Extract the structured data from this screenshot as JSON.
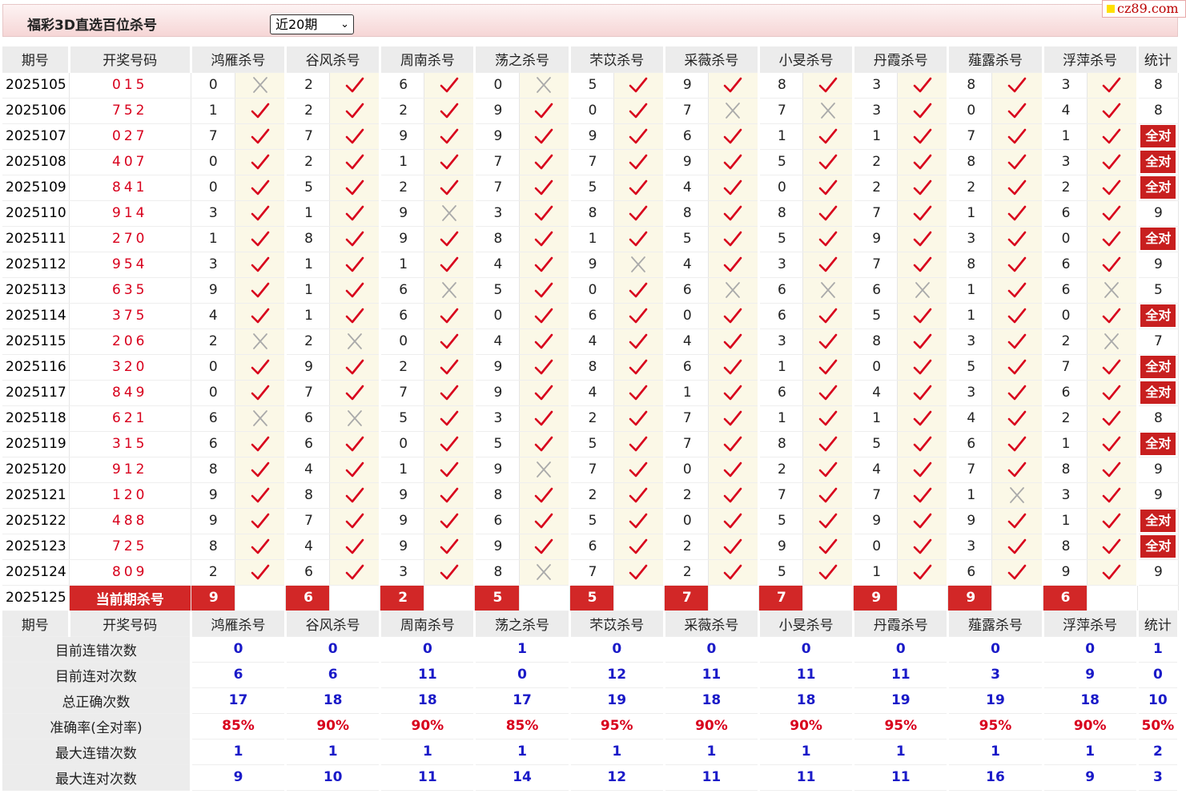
{
  "header": {
    "title": "福彩3D直选百位杀号",
    "select_value": "近20期",
    "logo": "cz89.com"
  },
  "table": {
    "headers": [
      "期号",
      "开奖号码",
      "鸿雁杀号",
      "谷风杀号",
      "周南杀号",
      "荡之杀号",
      "芣苡杀号",
      "采薇杀号",
      "小旻杀号",
      "丹霞杀号",
      "薤露杀号",
      "浮萍杀号",
      "统计"
    ],
    "rows": [
      {
        "period": "2025105",
        "draw": "015",
        "kills": [
          [
            "0",
            0
          ],
          [
            "2",
            1
          ],
          [
            "6",
            1
          ],
          [
            "0",
            0
          ],
          [
            "5",
            1
          ],
          [
            "9",
            1
          ],
          [
            "8",
            1
          ],
          [
            "3",
            1
          ],
          [
            "8",
            1
          ],
          [
            "3",
            1
          ]
        ],
        "stat": "8"
      },
      {
        "period": "2025106",
        "draw": "752",
        "kills": [
          [
            "1",
            1
          ],
          [
            "2",
            1
          ],
          [
            "2",
            1
          ],
          [
            "9",
            1
          ],
          [
            "0",
            1
          ],
          [
            "7",
            0
          ],
          [
            "7",
            0
          ],
          [
            "3",
            1
          ],
          [
            "0",
            1
          ],
          [
            "4",
            1
          ]
        ],
        "stat": "8"
      },
      {
        "period": "2025107",
        "draw": "027",
        "kills": [
          [
            "7",
            1
          ],
          [
            "7",
            1
          ],
          [
            "9",
            1
          ],
          [
            "9",
            1
          ],
          [
            "9",
            1
          ],
          [
            "6",
            1
          ],
          [
            "1",
            1
          ],
          [
            "1",
            1
          ],
          [
            "7",
            1
          ],
          [
            "1",
            1
          ]
        ],
        "stat": "全对"
      },
      {
        "period": "2025108",
        "draw": "407",
        "kills": [
          [
            "0",
            1
          ],
          [
            "2",
            1
          ],
          [
            "1",
            1
          ],
          [
            "7",
            1
          ],
          [
            "7",
            1
          ],
          [
            "9",
            1
          ],
          [
            "5",
            1
          ],
          [
            "2",
            1
          ],
          [
            "8",
            1
          ],
          [
            "3",
            1
          ]
        ],
        "stat": "全对"
      },
      {
        "period": "2025109",
        "draw": "841",
        "kills": [
          [
            "0",
            1
          ],
          [
            "5",
            1
          ],
          [
            "2",
            1
          ],
          [
            "7",
            1
          ],
          [
            "5",
            1
          ],
          [
            "4",
            1
          ],
          [
            "0",
            1
          ],
          [
            "2",
            1
          ],
          [
            "2",
            1
          ],
          [
            "2",
            1
          ]
        ],
        "stat": "全对"
      },
      {
        "period": "2025110",
        "draw": "914",
        "kills": [
          [
            "3",
            1
          ],
          [
            "1",
            1
          ],
          [
            "9",
            0
          ],
          [
            "3",
            1
          ],
          [
            "8",
            1
          ],
          [
            "8",
            1
          ],
          [
            "8",
            1
          ],
          [
            "7",
            1
          ],
          [
            "1",
            1
          ],
          [
            "6",
            1
          ]
        ],
        "stat": "9"
      },
      {
        "period": "2025111",
        "draw": "270",
        "kills": [
          [
            "1",
            1
          ],
          [
            "8",
            1
          ],
          [
            "9",
            1
          ],
          [
            "8",
            1
          ],
          [
            "1",
            1
          ],
          [
            "5",
            1
          ],
          [
            "5",
            1
          ],
          [
            "9",
            1
          ],
          [
            "3",
            1
          ],
          [
            "0",
            1
          ]
        ],
        "stat": "全对"
      },
      {
        "period": "2025112",
        "draw": "954",
        "kills": [
          [
            "3",
            1
          ],
          [
            "1",
            1
          ],
          [
            "1",
            1
          ],
          [
            "4",
            1
          ],
          [
            "9",
            0
          ],
          [
            "4",
            1
          ],
          [
            "3",
            1
          ],
          [
            "7",
            1
          ],
          [
            "8",
            1
          ],
          [
            "6",
            1
          ]
        ],
        "stat": "9"
      },
      {
        "period": "2025113",
        "draw": "635",
        "kills": [
          [
            "9",
            1
          ],
          [
            "1",
            1
          ],
          [
            "6",
            0
          ],
          [
            "5",
            1
          ],
          [
            "0",
            1
          ],
          [
            "6",
            0
          ],
          [
            "6",
            0
          ],
          [
            "6",
            0
          ],
          [
            "1",
            1
          ],
          [
            "6",
            0
          ]
        ],
        "stat": "5"
      },
      {
        "period": "2025114",
        "draw": "375",
        "kills": [
          [
            "4",
            1
          ],
          [
            "1",
            1
          ],
          [
            "6",
            1
          ],
          [
            "0",
            1
          ],
          [
            "6",
            1
          ],
          [
            "0",
            1
          ],
          [
            "6",
            1
          ],
          [
            "5",
            1
          ],
          [
            "1",
            1
          ],
          [
            "0",
            1
          ]
        ],
        "stat": "全对"
      },
      {
        "period": "2025115",
        "draw": "206",
        "kills": [
          [
            "2",
            0
          ],
          [
            "2",
            0
          ],
          [
            "0",
            1
          ],
          [
            "4",
            1
          ],
          [
            "4",
            1
          ],
          [
            "4",
            1
          ],
          [
            "3",
            1
          ],
          [
            "8",
            1
          ],
          [
            "3",
            1
          ],
          [
            "2",
            0
          ]
        ],
        "stat": "7"
      },
      {
        "period": "2025116",
        "draw": "320",
        "kills": [
          [
            "0",
            1
          ],
          [
            "9",
            1
          ],
          [
            "2",
            1
          ],
          [
            "9",
            1
          ],
          [
            "8",
            1
          ],
          [
            "6",
            1
          ],
          [
            "1",
            1
          ],
          [
            "0",
            1
          ],
          [
            "5",
            1
          ],
          [
            "7",
            1
          ]
        ],
        "stat": "全对"
      },
      {
        "period": "2025117",
        "draw": "849",
        "kills": [
          [
            "0",
            1
          ],
          [
            "7",
            1
          ],
          [
            "7",
            1
          ],
          [
            "9",
            1
          ],
          [
            "4",
            1
          ],
          [
            "1",
            1
          ],
          [
            "6",
            1
          ],
          [
            "4",
            1
          ],
          [
            "3",
            1
          ],
          [
            "6",
            1
          ]
        ],
        "stat": "全对"
      },
      {
        "period": "2025118",
        "draw": "621",
        "kills": [
          [
            "6",
            0
          ],
          [
            "6",
            0
          ],
          [
            "5",
            1
          ],
          [
            "3",
            1
          ],
          [
            "2",
            1
          ],
          [
            "7",
            1
          ],
          [
            "1",
            1
          ],
          [
            "1",
            1
          ],
          [
            "4",
            1
          ],
          [
            "2",
            1
          ]
        ],
        "stat": "8"
      },
      {
        "period": "2025119",
        "draw": "315",
        "kills": [
          [
            "6",
            1
          ],
          [
            "6",
            1
          ],
          [
            "0",
            1
          ],
          [
            "5",
            1
          ],
          [
            "5",
            1
          ],
          [
            "7",
            1
          ],
          [
            "8",
            1
          ],
          [
            "5",
            1
          ],
          [
            "6",
            1
          ],
          [
            "1",
            1
          ]
        ],
        "stat": "全对"
      },
      {
        "period": "2025120",
        "draw": "912",
        "kills": [
          [
            "8",
            1
          ],
          [
            "4",
            1
          ],
          [
            "1",
            1
          ],
          [
            "9",
            0
          ],
          [
            "7",
            1
          ],
          [
            "0",
            1
          ],
          [
            "2",
            1
          ],
          [
            "4",
            1
          ],
          [
            "7",
            1
          ],
          [
            "8",
            1
          ]
        ],
        "stat": "9"
      },
      {
        "period": "2025121",
        "draw": "120",
        "kills": [
          [
            "9",
            1
          ],
          [
            "8",
            1
          ],
          [
            "9",
            1
          ],
          [
            "8",
            1
          ],
          [
            "2",
            1
          ],
          [
            "2",
            1
          ],
          [
            "7",
            1
          ],
          [
            "7",
            1
          ],
          [
            "1",
            0
          ],
          [
            "3",
            1
          ]
        ],
        "stat": "9"
      },
      {
        "period": "2025122",
        "draw": "488",
        "kills": [
          [
            "9",
            1
          ],
          [
            "7",
            1
          ],
          [
            "9",
            1
          ],
          [
            "6",
            1
          ],
          [
            "5",
            1
          ],
          [
            "0",
            1
          ],
          [
            "5",
            1
          ],
          [
            "9",
            1
          ],
          [
            "9",
            1
          ],
          [
            "1",
            1
          ]
        ],
        "stat": "全对"
      },
      {
        "period": "2025123",
        "draw": "725",
        "kills": [
          [
            "8",
            1
          ],
          [
            "4",
            1
          ],
          [
            "9",
            1
          ],
          [
            "9",
            1
          ],
          [
            "6",
            1
          ],
          [
            "2",
            1
          ],
          [
            "9",
            1
          ],
          [
            "0",
            1
          ],
          [
            "3",
            1
          ],
          [
            "8",
            1
          ]
        ],
        "stat": "全对"
      },
      {
        "period": "2025124",
        "draw": "809",
        "kills": [
          [
            "2",
            1
          ],
          [
            "6",
            1
          ],
          [
            "3",
            1
          ],
          [
            "8",
            0
          ],
          [
            "7",
            1
          ],
          [
            "2",
            1
          ],
          [
            "5",
            1
          ],
          [
            "1",
            1
          ],
          [
            "6",
            1
          ],
          [
            "9",
            1
          ]
        ],
        "stat": "9"
      }
    ],
    "current": {
      "period": "2025125",
      "label": "当前期杀号",
      "kills": [
        "9",
        "6",
        "2",
        "5",
        "5",
        "7",
        "7",
        "9",
        "9",
        "6"
      ]
    }
  },
  "stats": {
    "headers": [
      "期号",
      "开奖号码",
      "鸿雁杀号",
      "谷风杀号",
      "周南杀号",
      "荡之杀号",
      "芣苡杀号",
      "采薇杀号",
      "小旻杀号",
      "丹霞杀号",
      "薤露杀号",
      "浮萍杀号",
      "统计"
    ],
    "rows": [
      {
        "label": "目前连错次数",
        "values": [
          "0",
          "0",
          "0",
          "1",
          "0",
          "0",
          "0",
          "0",
          "0",
          "0",
          "1"
        ],
        "red": false
      },
      {
        "label": "目前连对次数",
        "values": [
          "6",
          "6",
          "11",
          "0",
          "12",
          "11",
          "11",
          "11",
          "3",
          "9",
          "0"
        ],
        "red": false
      },
      {
        "label": "总正确次数",
        "values": [
          "17",
          "18",
          "18",
          "17",
          "19",
          "18",
          "18",
          "19",
          "19",
          "18",
          "10"
        ],
        "red": false
      },
      {
        "label": "准确率(全对率)",
        "values": [
          "85%",
          "90%",
          "90%",
          "85%",
          "95%",
          "90%",
          "90%",
          "95%",
          "95%",
          "90%",
          "50%"
        ],
        "red": true
      },
      {
        "label": "最大连错次数",
        "values": [
          "1",
          "1",
          "1",
          "1",
          "1",
          "1",
          "1",
          "1",
          "1",
          "1",
          "2"
        ],
        "red": false
      },
      {
        "label": "最大连对次数",
        "values": [
          "9",
          "10",
          "11",
          "14",
          "12",
          "11",
          "11",
          "11",
          "16",
          "9",
          "3"
        ],
        "red": false
      }
    ]
  },
  "colors": {
    "check": "#d8001c",
    "cross": "#aaaaaa",
    "badge": "#c81f1f",
    "stat_blue": "#1a1ac8"
  }
}
